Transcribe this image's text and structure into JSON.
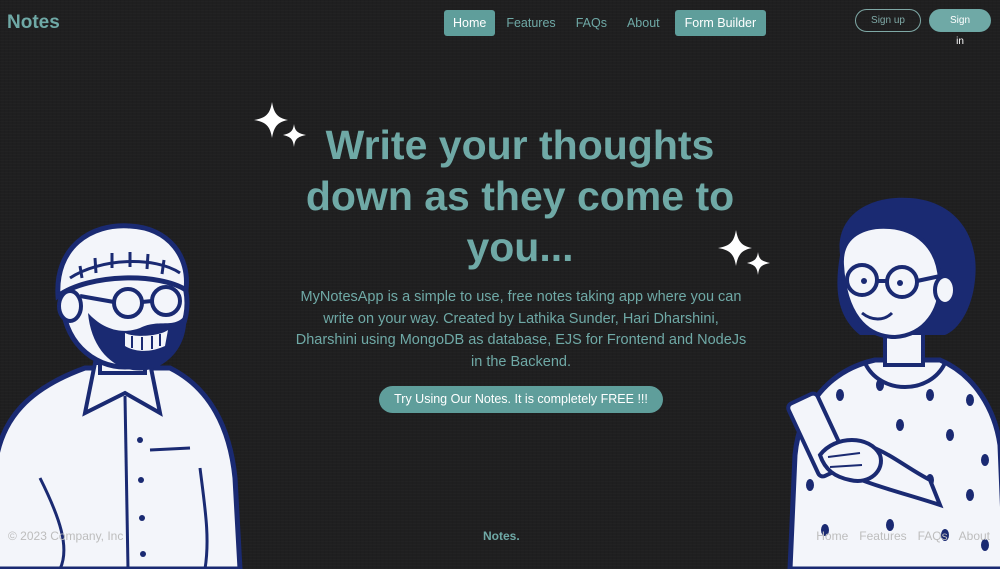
{
  "header": {
    "brand": "Notes",
    "nav": [
      "Home",
      "Features",
      "FAQs",
      "About",
      "Form Builder"
    ],
    "signup": "Sign up",
    "signin": "Sign in"
  },
  "hero": {
    "title": "Write your thoughts down as they come to you...",
    "description": "MyNotesApp is a simple to use, free notes taking app where you can write on your way. Created by Lathika Sunder, Hari Dharshini, Dharshini using MongoDB as database, EJS for Frontend and NodeJs in the Backend.",
    "cta": "Try Using Our Notes. It is completely FREE !!!"
  },
  "footer": {
    "copyright": "© 2023 Company, Inc",
    "brand": "Notes.",
    "links": [
      "Home",
      "Features",
      "FAQs",
      "About"
    ]
  },
  "colors": {
    "accent": "#6fa9a6",
    "background": "#1f1f20",
    "illustration_outline": "#1a2a72"
  }
}
